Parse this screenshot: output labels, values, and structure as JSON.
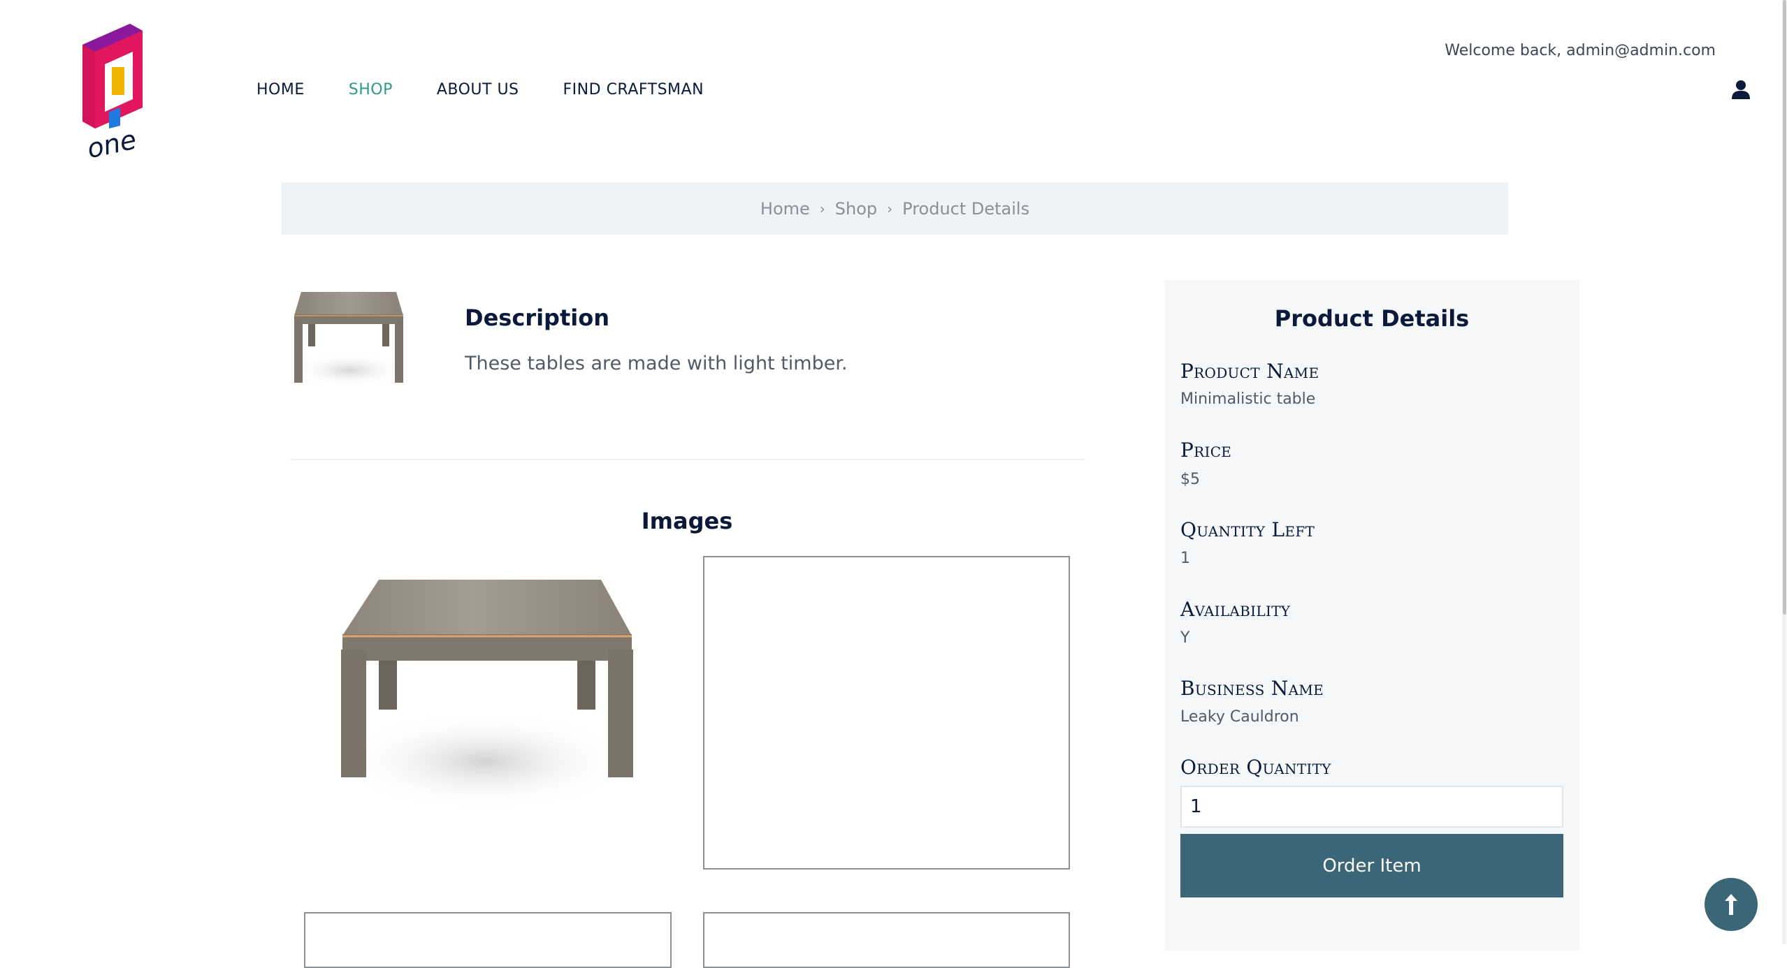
{
  "header": {
    "logo_text": "one",
    "nav": [
      {
        "label": "HOME",
        "active": false
      },
      {
        "label": "SHOP",
        "active": true
      },
      {
        "label": "ABOUT US",
        "active": false
      },
      {
        "label": "FIND CRAFTSMAN",
        "active": false
      }
    ],
    "welcome": "Welcome back, admin@admin.com"
  },
  "breadcrumb": {
    "items": [
      "Home",
      "Shop",
      "Product Details"
    ]
  },
  "description": {
    "title": "Description",
    "text": "These tables are made with light timber."
  },
  "images": {
    "title": "Images"
  },
  "details": {
    "title": "Product Details",
    "fields": [
      {
        "label": "Product Name",
        "value": "Minimalistic table"
      },
      {
        "label": "Price",
        "value": "$5"
      },
      {
        "label": "Quantity Left",
        "value": "1"
      },
      {
        "label": "Availability",
        "value": "Y"
      },
      {
        "label": "Business Name",
        "value": "Leaky Cauldron"
      }
    ],
    "order_quantity_label": "Order Quantity",
    "order_quantity_value": "1",
    "order_button": "Order Item"
  },
  "colors": {
    "accent": "#2e9b84",
    "button": "#3a6678",
    "panel_bg": "#f5f7f9",
    "breadcrumb_bg": "#eff3f6"
  }
}
